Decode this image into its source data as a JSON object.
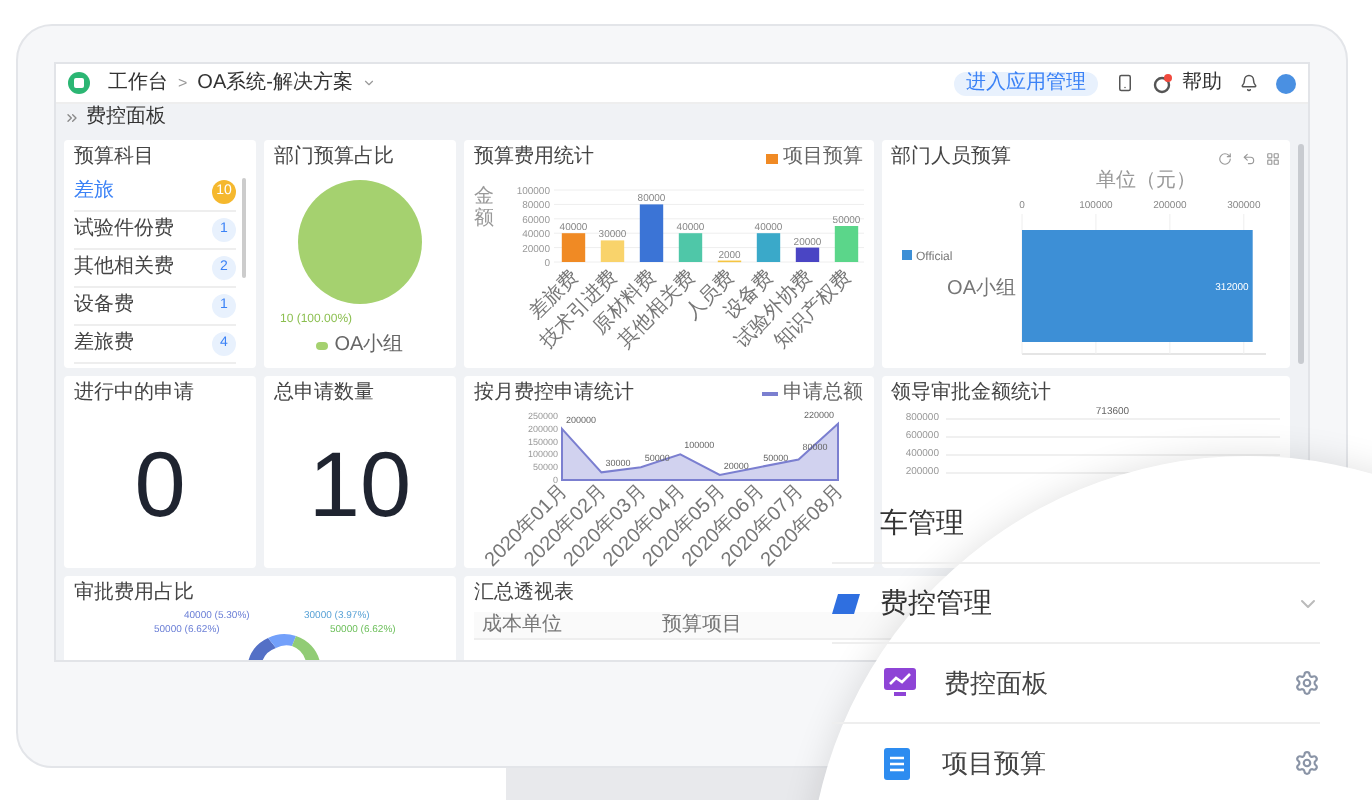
{
  "header": {
    "breadcrumb": [
      "工作台",
      "OA系统-解决方案"
    ],
    "separator": ">",
    "manage_button": "进入应用管理",
    "help": "帮助"
  },
  "page_title": "费控面板",
  "budget_subjects": {
    "title": "预算科目",
    "items": [
      {
        "label": "差旅",
        "count": "10",
        "selected": true
      },
      {
        "label": "试验件份费",
        "count": "1",
        "selected": false
      },
      {
        "label": "其他相关费",
        "count": "2",
        "selected": false
      },
      {
        "label": "设备费",
        "count": "1",
        "selected": false
      },
      {
        "label": "差旅费",
        "count": "4",
        "selected": false
      }
    ]
  },
  "dept_budget_share": {
    "title": "部门预算占比",
    "chart_data": {
      "type": "pie",
      "categories": [
        "OA小组"
      ],
      "series": [
        {
          "color": "#a5d16f",
          "values": [
            100
          ]
        }
      ],
      "value_labels": [
        "10 (100.00%)"
      ]
    }
  },
  "budget_stats": {
    "title": "预算费用统计",
    "chart_data": {
      "type": "bar",
      "ylabel": "金额",
      "categories": [
        "差旅费",
        "技术引进费",
        "原材料费",
        "其他相关费",
        "人员费",
        "设备费",
        "试验外协费",
        "知识产权费"
      ],
      "series": [
        {
          "name": "项目预算",
          "color": "#f08a24",
          "colors": [
            "#f08a24",
            "#f9d36b",
            "#3b74d6",
            "#4fc7a8",
            "#f5c542",
            "#3aa9c9",
            "#4a45c4",
            "#5bd68a"
          ],
          "values": [
            40000,
            30000,
            80000,
            40000,
            2000,
            40000,
            20000,
            50000
          ]
        }
      ],
      "ylim": [
        0,
        100000
      ],
      "yticks": [
        0,
        20000,
        40000,
        60000,
        80000,
        100000
      ],
      "grid": true,
      "data_labels": true
    }
  },
  "dept_staff_budget": {
    "title": "部门人员预算",
    "chart_data": {
      "type": "bar",
      "orientation": "horizontal",
      "xlabel": "单位（元）",
      "categories": [
        "OA小组"
      ],
      "series": [
        {
          "name": "Official",
          "color": "#3d8fd6",
          "values": [
            312000
          ]
        }
      ],
      "xlim": [
        0,
        330000
      ],
      "xticks": [
        0,
        100000,
        200000,
        300000
      ],
      "grid": true,
      "data_labels": true
    }
  },
  "in_progress": {
    "title": "进行中的申请",
    "value": "0"
  },
  "total_requests": {
    "title": "总申请数量",
    "value": "10"
  },
  "monthly_requests": {
    "title": "按月费控申请统计",
    "chart_data": {
      "type": "area",
      "categories": [
        "2020年01月",
        "2020年02月",
        "2020年03月",
        "2020年04月",
        "2020年05月",
        "2020年06月",
        "2020年07月",
        "2020年08月"
      ],
      "series": [
        {
          "name": "申请总额",
          "color": "#7b7fd0",
          "values": [
            200000,
            30000,
            50000,
            100000,
            20000,
            50000,
            80000,
            220000
          ]
        }
      ],
      "ylim": [
        0,
        250000
      ],
      "yticks": [
        0,
        50000,
        100000,
        150000,
        200000,
        250000
      ],
      "data_labels": true
    }
  },
  "leader_approval": {
    "title": "领导审批金额统计",
    "y_axis_labels": [
      "800000",
      "600000",
      "400000",
      "200000"
    ],
    "value_label": "713600"
  },
  "approval_share": {
    "title": "审批费用占比",
    "slice_labels": [
      "40000 (5.30%)",
      "50000 (6.62%)",
      "30000 (3.97%)",
      "50000 (6.62%)"
    ]
  },
  "summary_table": {
    "title": "汇总透视表",
    "columns": [
      "成本单位",
      "预算项目"
    ]
  },
  "menu_zoom": {
    "items": [
      {
        "kind": "section",
        "label": "车管理"
      },
      {
        "kind": "group",
        "label": "费控管理",
        "expanded": true
      },
      {
        "kind": "item",
        "label": "费控面板"
      },
      {
        "kind": "item",
        "label": "项目预算"
      }
    ]
  }
}
